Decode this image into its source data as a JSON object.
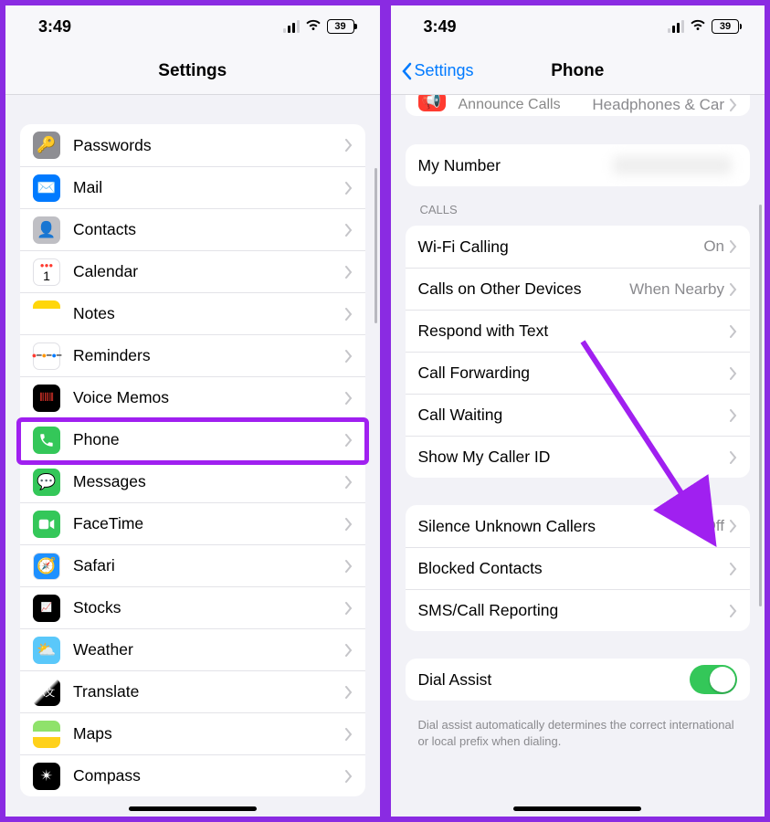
{
  "status": {
    "time": "3:49",
    "battery": "39"
  },
  "left": {
    "title": "Settings",
    "items": [
      {
        "label": "Passwords",
        "iconName": "key-icon"
      },
      {
        "label": "Mail",
        "iconName": "mail-icon"
      },
      {
        "label": "Contacts",
        "iconName": "contacts-icon"
      },
      {
        "label": "Calendar",
        "iconName": "calendar-icon"
      },
      {
        "label": "Notes",
        "iconName": "notes-icon"
      },
      {
        "label": "Reminders",
        "iconName": "reminders-icon"
      },
      {
        "label": "Voice Memos",
        "iconName": "voicememos-icon"
      },
      {
        "label": "Phone",
        "iconName": "phone-icon"
      },
      {
        "label": "Messages",
        "iconName": "messages-icon"
      },
      {
        "label": "FaceTime",
        "iconName": "facetime-icon"
      },
      {
        "label": "Safari",
        "iconName": "safari-icon"
      },
      {
        "label": "Stocks",
        "iconName": "stocks-icon"
      },
      {
        "label": "Weather",
        "iconName": "weather-icon"
      },
      {
        "label": "Translate",
        "iconName": "translate-icon"
      },
      {
        "label": "Maps",
        "iconName": "maps-icon"
      },
      {
        "label": "Compass",
        "iconName": "compass-icon"
      }
    ]
  },
  "right": {
    "backLabel": "Settings",
    "title": "Phone",
    "announce": {
      "label": "Announce Calls",
      "detail": "Headphones & Car"
    },
    "myNumber": {
      "label": "My Number"
    },
    "callsHeader": "CALLS",
    "callsGroup": [
      {
        "label": "Wi-Fi Calling",
        "detail": "On"
      },
      {
        "label": "Calls on Other Devices",
        "detail": "When Nearby"
      },
      {
        "label": "Respond with Text"
      },
      {
        "label": "Call Forwarding"
      },
      {
        "label": "Call Waiting"
      },
      {
        "label": "Show My Caller ID"
      }
    ],
    "silenceGroup": [
      {
        "label": "Silence Unknown Callers",
        "detail": "Off"
      },
      {
        "label": "Blocked Contacts"
      },
      {
        "label": "SMS/Call Reporting"
      }
    ],
    "dialAssist": {
      "label": "Dial Assist"
    },
    "dialAssistFooter": "Dial assist automatically determines the correct international or local prefix when dialing."
  }
}
